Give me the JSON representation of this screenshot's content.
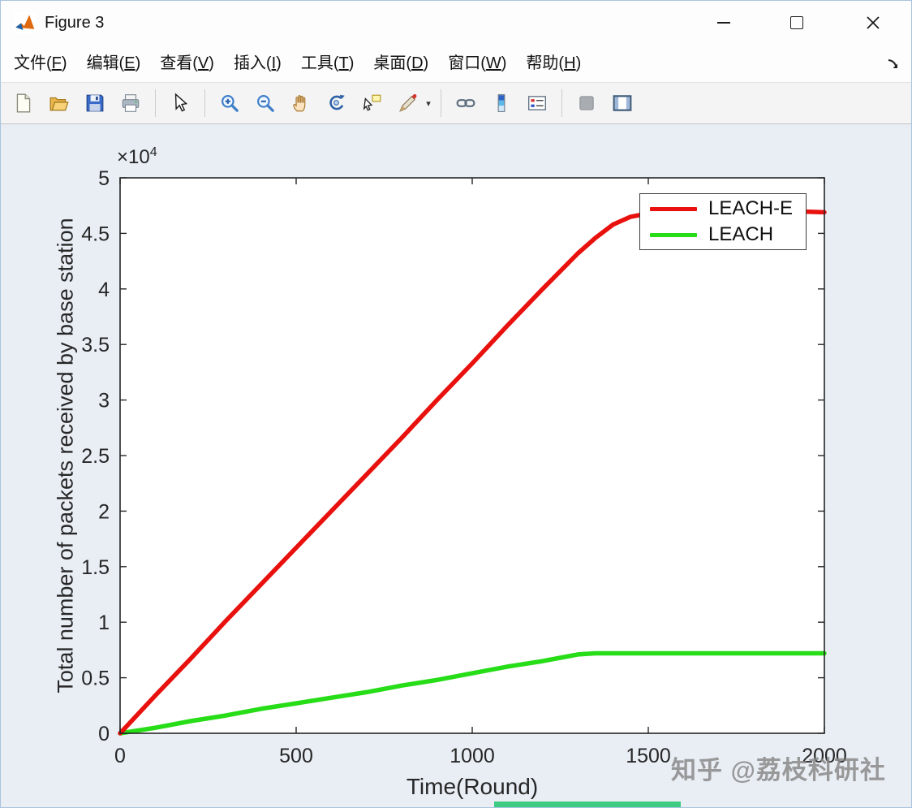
{
  "window": {
    "title": "Figure 3",
    "controls": [
      "minimize",
      "maximize",
      "close"
    ]
  },
  "menu": {
    "items": [
      {
        "pre": "文件(",
        "key": "F",
        "post": ")"
      },
      {
        "pre": "编辑(",
        "key": "E",
        "post": ")"
      },
      {
        "pre": "查看(",
        "key": "V",
        "post": ")"
      },
      {
        "pre": "插入(",
        "key": "I",
        "post": ")"
      },
      {
        "pre": "工具(",
        "key": "T",
        "post": ")"
      },
      {
        "pre": "桌面(",
        "key": "D",
        "post": ")"
      },
      {
        "pre": "窗口(",
        "key": "W",
        "post": ")"
      },
      {
        "pre": "帮助(",
        "key": "H",
        "post": ")"
      }
    ]
  },
  "toolbar": {
    "icons": [
      "new-figure",
      "open-file",
      "save-figure",
      "print-figure",
      "pointer",
      "zoom-in",
      "zoom-out",
      "pan",
      "rotate-3d",
      "data-cursor",
      "brush",
      "brush-dropdown",
      "link-plot",
      "insert-colorbar",
      "insert-legend",
      "edit-plot",
      "show-plot-tools"
    ]
  },
  "chart_data": {
    "type": "line",
    "title": "",
    "xlabel": "Time(Round)",
    "ylabel": "Total number of packets received by base station",
    "y_offset": {
      "base": "×10",
      "exp": "4"
    },
    "xlim": [
      0,
      2000
    ],
    "ylim": [
      0,
      5
    ],
    "xticks": [
      0,
      500,
      1000,
      1500,
      2000
    ],
    "yticks": [
      0,
      0.5,
      1,
      1.5,
      2,
      2.5,
      3,
      3.5,
      4,
      4.5,
      5
    ],
    "grid": false,
    "legend_position": "top-right",
    "axis_color": "#262626",
    "series": [
      {
        "name": "LEACH-E",
        "color": "#e8110d",
        "x": [
          0,
          100,
          200,
          300,
          400,
          500,
          600,
          700,
          800,
          900,
          1000,
          1100,
          1200,
          1250,
          1300,
          1350,
          1400,
          1450,
          1500,
          1600,
          1700,
          1800,
          1900,
          2000
        ],
        "values": [
          0,
          0.34,
          0.67,
          1.01,
          1.34,
          1.67,
          2.0,
          2.33,
          2.66,
          3.0,
          3.33,
          3.67,
          4.0,
          4.16,
          4.32,
          4.46,
          4.58,
          4.65,
          4.68,
          4.7,
          4.7,
          4.7,
          4.7,
          4.69
        ]
      },
      {
        "name": "LEACH",
        "color": "#26dd17",
        "x": [
          0,
          100,
          200,
          300,
          400,
          500,
          600,
          700,
          800,
          900,
          1000,
          1100,
          1200,
          1250,
          1300,
          1350,
          1400,
          1500,
          1600,
          1700,
          1800,
          1900,
          2000
        ],
        "values": [
          0,
          0.05,
          0.11,
          0.16,
          0.22,
          0.27,
          0.32,
          0.37,
          0.43,
          0.48,
          0.54,
          0.6,
          0.65,
          0.68,
          0.71,
          0.72,
          0.72,
          0.72,
          0.72,
          0.72,
          0.72,
          0.72,
          0.72
        ]
      }
    ]
  },
  "watermark": "知乎 @荔枝科研社"
}
